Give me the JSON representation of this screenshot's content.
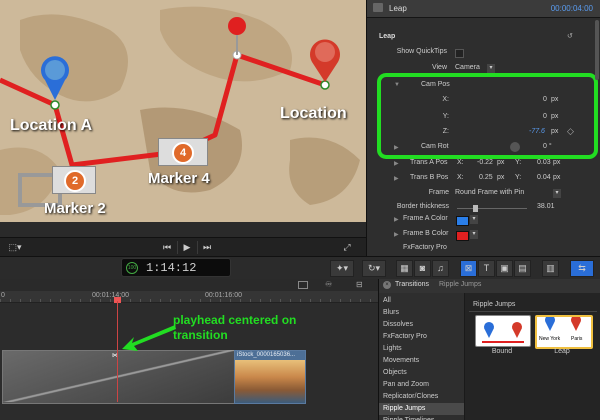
{
  "viewer": {
    "map_labels": {
      "location_a": "Location  A",
      "location": "Location",
      "marker2": "Marker 2",
      "marker4": "Marker 4",
      "badge2": "2",
      "badge4": "4"
    }
  },
  "inspector": {
    "title": "Leap",
    "time": "00:00:04:00",
    "section": "Leap",
    "show_quicktips": "Show QuickTips",
    "view_label": "View",
    "view_value": "Camera",
    "cam_pos": "Cam Pos",
    "x_label": "X:",
    "x_value": "0",
    "x_unit": "px",
    "y_label": "Y:",
    "y_value": "0",
    "y_unit": "px",
    "z_label": "Z:",
    "z_value": "-77.6",
    "z_unit": "px",
    "cam_rot": "Cam Rot",
    "cam_rot_value": "0 °",
    "trans_a": "Trans A Pos",
    "trans_a_x": "-0.22",
    "trans_a_y": "0.03",
    "trans_b": "Trans B Pos",
    "trans_b_x": "0.25",
    "trans_b_y": "0.04",
    "px": "px",
    "xl": "X:",
    "yl": "Y:",
    "frame_label": "Frame",
    "frame_value": "Round Frame with Pin",
    "border_label": "Border thickness",
    "border_value": "38.01",
    "frame_a_color": "Frame A Color",
    "frame_b_color": "Frame B Color",
    "fx_label": "FxFactory Pro"
  },
  "toolbar": {
    "timecode": "1:14:12",
    "timecode_small": "100"
  },
  "timeline": {
    "ruler": [
      "00:01:14:00",
      "00:01:16:00"
    ],
    "ruler_start": "0",
    "clip2_name": "iStock_0000165036...",
    "annotation": "playhead centered on transition"
  },
  "browser": {
    "header": "Transitions",
    "crumb": "Ripple Jumps",
    "items": [
      "All",
      "Blurs",
      "Dissolves",
      "FxFactory Pro",
      "Lights",
      "Movements",
      "Objects",
      "Pan and Zoom",
      "Replicator/Clones",
      "Ripple Jumps",
      "Ripple Timelines"
    ],
    "group_title": "Ripple Jumps",
    "thumbs": [
      {
        "label": "Bound",
        "t1": "",
        "t2": ""
      },
      {
        "label": "Leap",
        "t1": "New York",
        "t2": "Paris"
      }
    ]
  },
  "colors": {
    "accent": "#5a9cf0",
    "highlight": "#22dd22",
    "frame_a": "#2a7ee8",
    "frame_b": "#e02020",
    "route": "#e02020"
  }
}
